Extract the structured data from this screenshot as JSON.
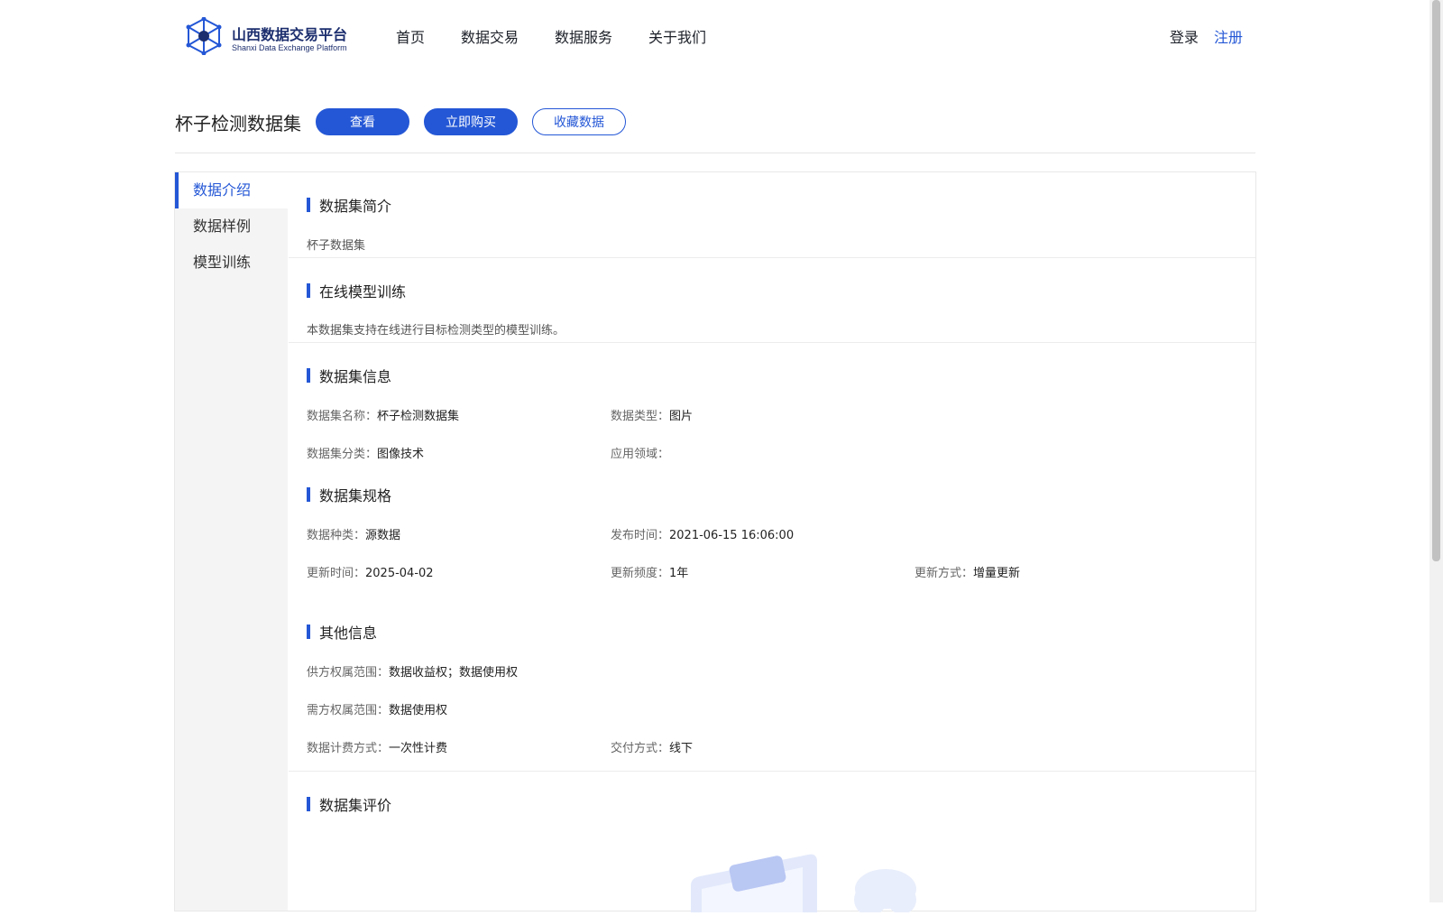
{
  "header": {
    "logo_name": "山西数据交易平台",
    "logo_sub": "Shanxi Data Exchange Platform",
    "nav": [
      "首页",
      "数据交易",
      "数据服务",
      "关于我们"
    ],
    "login": "登录",
    "register": "注册"
  },
  "dataset": {
    "title": "杯子检测数据集",
    "btn_view": "查看",
    "btn_buy": "立即购买",
    "btn_fav": "收藏数据"
  },
  "sidebar": {
    "items": [
      {
        "label": "数据介绍",
        "active": true
      },
      {
        "label": "数据样例",
        "active": false
      },
      {
        "label": "模型训练",
        "active": false
      }
    ]
  },
  "sections": {
    "intro": {
      "title": "数据集简介",
      "text": "杯子数据集"
    },
    "training": {
      "title": "在线模型训练",
      "text": "本数据集支持在线进行目标检测类型的模型训练。"
    },
    "info": {
      "title": "数据集信息",
      "name_k": "数据集名称：",
      "name_v": "杯子检测数据集",
      "type_k": "数据类型：",
      "type_v": "图片",
      "cat_k": "数据集分类：",
      "cat_v": "图像技术",
      "field_k": "应用领域：",
      "field_v": ""
    },
    "spec": {
      "title": "数据集规格",
      "kind_k": "数据种类：",
      "kind_v": "源数据",
      "pub_k": "发布时间：",
      "pub_v": "2021-06-15 16:06:00",
      "upd_k": "更新时间：",
      "upd_v": "2025-04-02",
      "freq_k": "更新频度：",
      "freq_v": "1年",
      "mode_k": "更新方式：",
      "mode_v": "增量更新"
    },
    "other": {
      "title": "其他信息",
      "supply_k": "供方权属范围：",
      "supply_v": "数据收益权；数据使用权",
      "demand_k": "需方权属范围：",
      "demand_v": "数据使用权",
      "billing_k": "数据计费方式：",
      "billing_v": "一次性计费",
      "delivery_k": "交付方式：",
      "delivery_v": "线下"
    },
    "review": {
      "title": "数据集评价"
    }
  },
  "colors": {
    "accent": "#2457d6",
    "sidebar_bg": "#f4f4f4"
  }
}
